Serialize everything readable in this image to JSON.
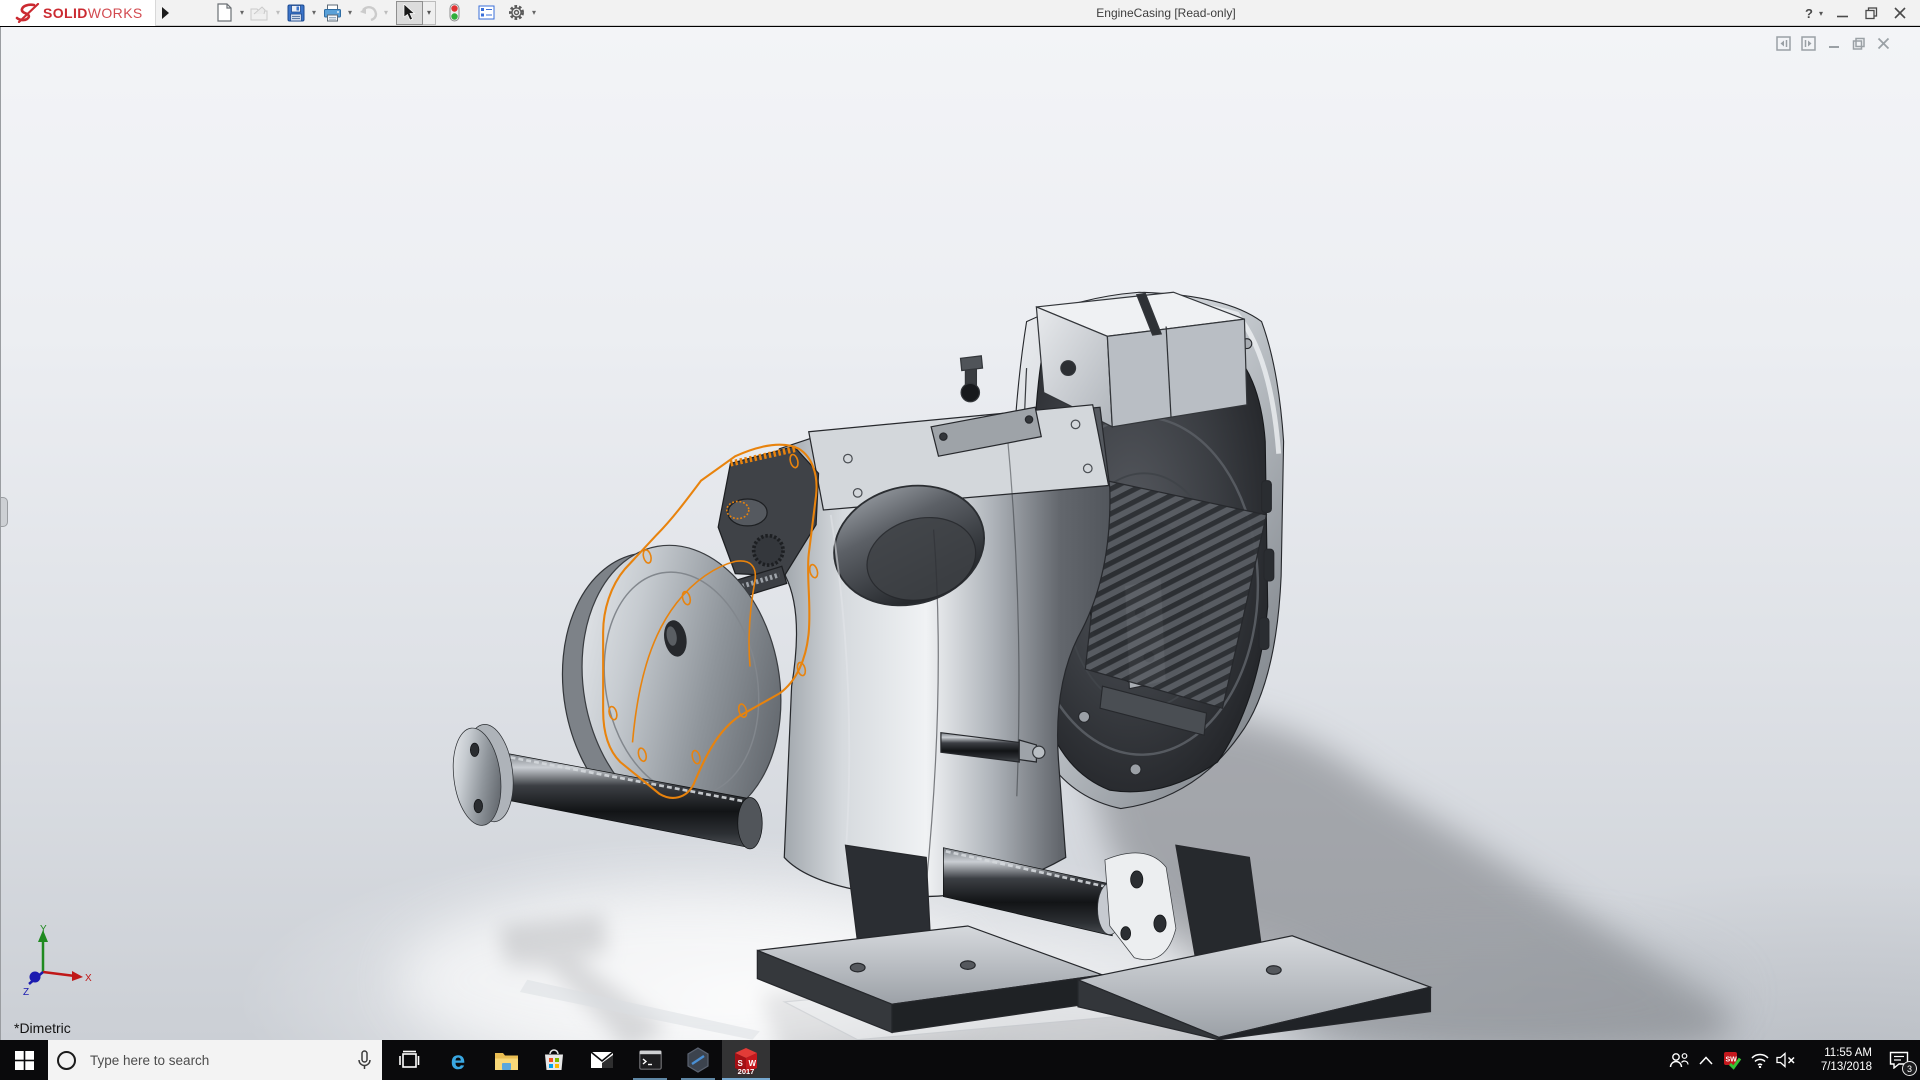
{
  "window": {
    "title": "EngineCasing [Read-only]",
    "brand": {
      "bold": "SOLID",
      "light": "WORKS"
    },
    "help_glyph": "?"
  },
  "viewport": {
    "view_label": "*Dimetric",
    "triad": {
      "x_label": "X",
      "y_label": "Y",
      "z_label": "Z"
    },
    "sketch_color": "#E8830D"
  },
  "taskbar": {
    "search_placeholder": "Type here to search",
    "edge_glyph": "e",
    "solidworks": {
      "letters": "SW",
      "year": "2017"
    },
    "tray": {
      "sw_letters": "SW",
      "time": "11:55 AM",
      "date": "7/13/2018",
      "notifications": "3"
    }
  }
}
